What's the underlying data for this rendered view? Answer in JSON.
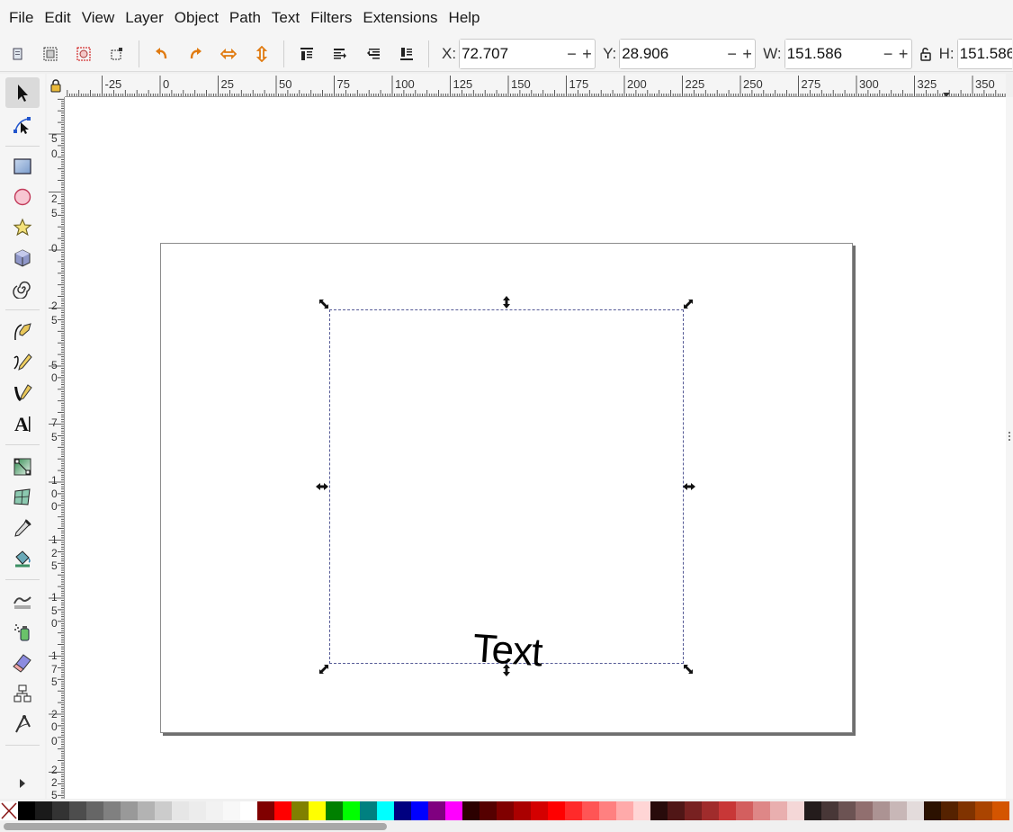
{
  "menu": [
    "File",
    "Edit",
    "View",
    "Layer",
    "Object",
    "Path",
    "Text",
    "Filters",
    "Extensions",
    "Help"
  ],
  "toolbar": {
    "x_label": "X:",
    "x_value": "72.707",
    "y_label": "Y:",
    "y_value": "28.906",
    "w_label": "W:",
    "w_value": "151.586",
    "h_label": "H:",
    "h_value": "151.586",
    "minus": "−",
    "plus": "+"
  },
  "ruler": {
    "h_labels": [
      "-25",
      "0",
      "25",
      "50",
      "75",
      "100",
      "125",
      "150",
      "175",
      "200",
      "225",
      "250",
      "275",
      "300",
      "325",
      "350"
    ],
    "v_labels": [
      "5",
      "0",
      "2",
      "5",
      "0",
      "2",
      "5",
      "5",
      "0",
      "7",
      "5",
      "1",
      "0",
      "0",
      "1",
      "2",
      "5",
      "1",
      "5",
      "0",
      "1",
      "7",
      "5",
      "2",
      "0",
      "0",
      "2",
      "2",
      "5"
    ]
  },
  "canvas": {
    "text": "Text"
  },
  "palette": {
    "colors": [
      "#000000",
      "#1a1a1a",
      "#333333",
      "#4d4d4d",
      "#666666",
      "#808080",
      "#999999",
      "#b3b3b3",
      "#cccccc",
      "#e6e6e6",
      "#ececec",
      "#f2f2f2",
      "#f8f8f8",
      "#ffffff",
      "#800000",
      "#ff0000",
      "#808000",
      "#ffff00",
      "#008000",
      "#00ff00",
      "#008080",
      "#00ffff",
      "#000080",
      "#0000ff",
      "#800080",
      "#ff00ff",
      "#2b0000",
      "#550000",
      "#800000",
      "#aa0000",
      "#d40000",
      "#ff0000",
      "#ff2a2a",
      "#ff5555",
      "#ff8080",
      "#ffaaaa",
      "#ffd5d5",
      "#280b0b",
      "#501616",
      "#782121",
      "#a02c2c",
      "#c83737",
      "#d35f5f",
      "#de8787",
      "#e9afaf",
      "#f4d7d7",
      "#241c1c",
      "#483737",
      "#6c5353",
      "#916f6f",
      "#ac9393",
      "#c8b7b7",
      "#e3dbdb",
      "#2b1100",
      "#552200",
      "#803300",
      "#aa4400",
      "#d45500"
    ]
  }
}
